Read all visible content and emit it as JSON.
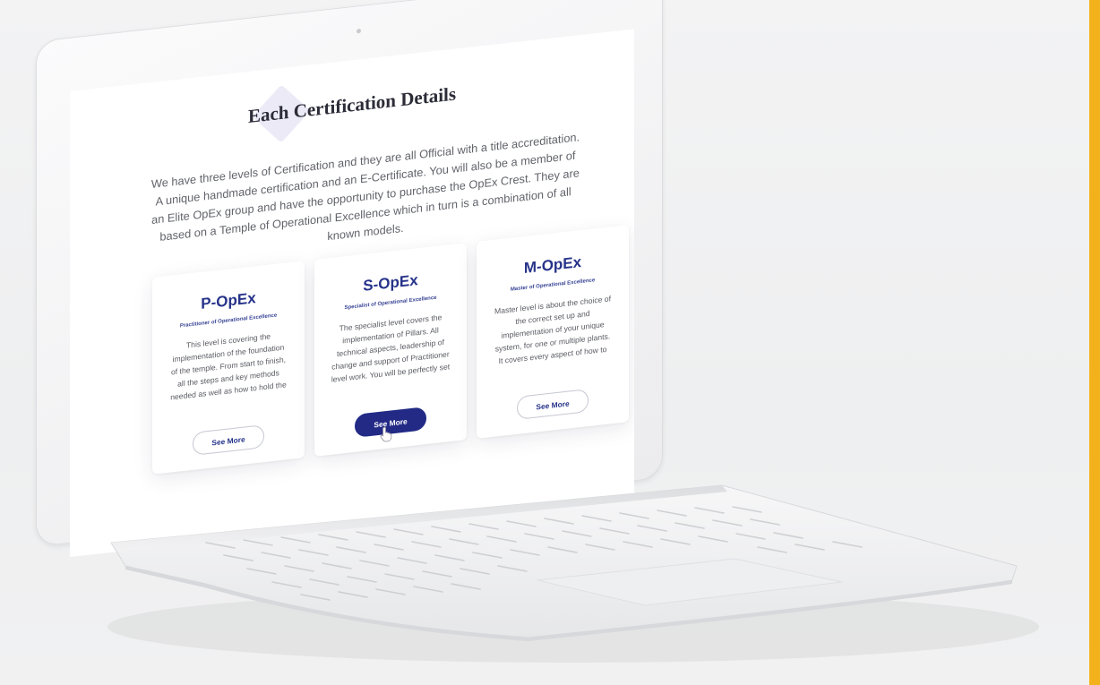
{
  "page": {
    "title": "Each Certification Details",
    "intro": "We have three levels of Certification and they are all Official with a title accreditation. A unique handmade certification and an E-Certificate. You will also be a member of an Elite OpEx group and have the opportunity to purchase the OpEx Crest. They are based on a Temple of Operational Excellence which in turn is a combination of all known models."
  },
  "cards": [
    {
      "title": "P-OpEx",
      "subtitle": "Practitioner of Operational Excellence",
      "body": "This level is covering the implementation of the foundation of the temple. From start to finish, all the steps and key methods needed as well as how to hold the",
      "button": "See More"
    },
    {
      "title": "S-OpEx",
      "subtitle": "Specialist of Operational Excellence",
      "body": "The specialist level covers the implementation of Pillars. All technical aspects, leadership of change and support of Practitioner level work. You will be perfectly set",
      "button": "See More"
    },
    {
      "title": "M-OpEx",
      "subtitle": "Master of Operational Excellence",
      "body": "Master level is about the choice of the correct set up and implementation of your unique system, for one or multiple plants. It covers every aspect of how to",
      "button": "See More"
    }
  ],
  "colors": {
    "accent": "#f3b21c",
    "brand": "#26338a",
    "button_filled": "#222a86"
  },
  "icons": {
    "cursor": "hand-pointer-icon"
  }
}
